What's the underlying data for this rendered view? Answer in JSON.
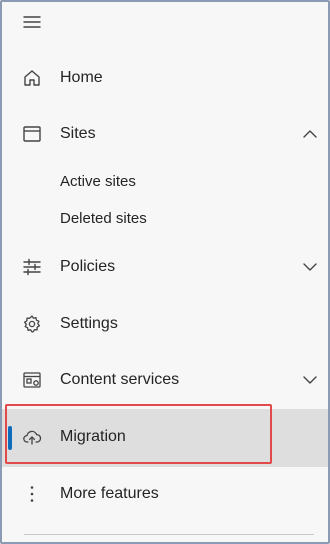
{
  "nav": {
    "menu_icon": "hamburger-icon",
    "items": [
      {
        "label": "Home",
        "icon": "home-icon"
      },
      {
        "label": "Sites",
        "icon": "sites-icon",
        "expanded": true,
        "chevron": "chevron-up-icon"
      },
      {
        "label": "Active sites"
      },
      {
        "label": "Deleted sites"
      },
      {
        "label": "Policies",
        "icon": "sliders-icon",
        "chevron": "chevron-down-icon"
      },
      {
        "label": "Settings",
        "icon": "gear-icon"
      },
      {
        "label": "Content services",
        "icon": "content-services-icon",
        "chevron": "chevron-down-icon"
      },
      {
        "label": "Migration",
        "icon": "cloud-upload-icon",
        "selected": true
      },
      {
        "label": "More features",
        "icon": "more-vertical-icon"
      }
    ]
  },
  "colors": {
    "accent": "#0f6cbd",
    "highlight_border": "#e04a4a",
    "selected_bg": "#dedede"
  }
}
